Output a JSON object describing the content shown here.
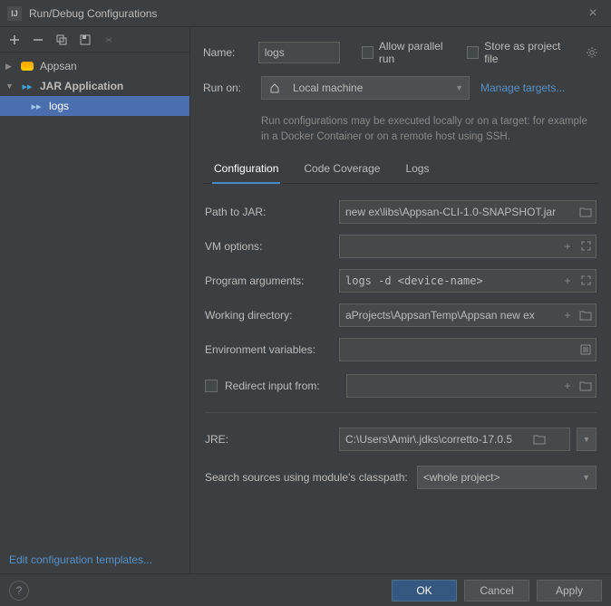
{
  "window": {
    "title": "Run/Debug Configurations"
  },
  "tree": {
    "items": [
      {
        "label": "Appsan",
        "type": "group"
      },
      {
        "label": "JAR Application",
        "type": "group"
      },
      {
        "label": "logs",
        "type": "config"
      }
    ]
  },
  "edit_templates": "Edit configuration templates...",
  "form": {
    "name_label": "Name:",
    "name_value": "logs",
    "parallel_label": "Allow parallel run",
    "store_label": "Store as project file",
    "runon_label": "Run on:",
    "runon_value": "Local machine",
    "manage_targets": "Manage targets...",
    "hint": "Run configurations may be executed locally or on a target: for example in a Docker Container or on a remote host using SSH."
  },
  "tabs": [
    {
      "label": "Configuration"
    },
    {
      "label": "Code Coverage"
    },
    {
      "label": "Logs"
    }
  ],
  "config": {
    "jar_label": "Path to JAR:",
    "jar_value": "new ex\\libs\\Appsan-CLI-1.0-SNAPSHOT.jar",
    "vm_label": "VM options:",
    "vm_value": "",
    "args_label": "Program arguments:",
    "args_value": "logs -d <device-name>",
    "wd_label": "Working directory:",
    "wd_value": "aProjects\\AppsanTemp\\Appsan new ex",
    "env_label": "Environment variables:",
    "env_value": "",
    "redirect_label": "Redirect input from:",
    "redirect_value": "",
    "jre_label": "JRE:",
    "jre_value": "C:\\Users\\Amir\\.jdks\\corretto-17.0.5",
    "search_label": "Search sources using module's classpath:",
    "search_value": "<whole project>"
  },
  "buttons": {
    "ok": "OK",
    "cancel": "Cancel",
    "apply": "Apply"
  }
}
